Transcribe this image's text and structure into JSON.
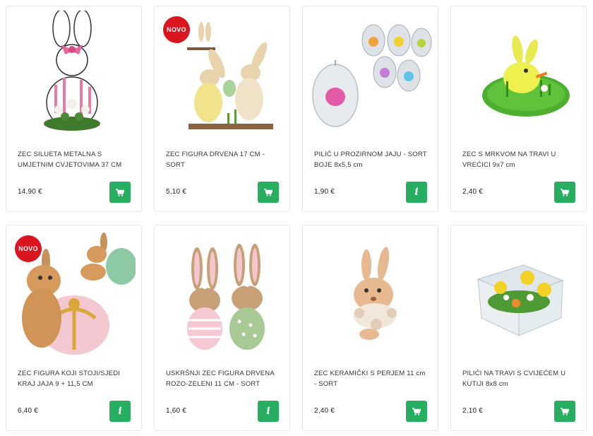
{
  "products": [
    {
      "title": "ZEC SILUETA METALNA S UMJETNIM CVJETOVIMA 37 CM",
      "price": "14,90 €",
      "badge": "",
      "action": "cart-icon"
    },
    {
      "title": "ZEC FIGURA DRVENA 17 CM - SORT",
      "price": "5,10 €",
      "badge": "NOVO",
      "action": "cart-icon"
    },
    {
      "title": "PILIĆ U PROZIRNOM JAJU - SORT BOJE 8x5,5 cm",
      "price": "1,90 €",
      "badge": "",
      "action": "info-icon"
    },
    {
      "title": "ZEC S MRKVOM NA TRAVI U VREĆICI 9x7 cm",
      "price": "2,40 €",
      "badge": "",
      "action": "cart-icon"
    },
    {
      "title": "ZEC FIGURA KOJI STOJI/SJEDI KRAJ JAJA 9 + 11,5 CM",
      "price": "6,40 €",
      "badge": "NOVO",
      "action": "info-icon"
    },
    {
      "title": "USKRŠNJI ZEC FIGURA DRVENA ROZO-ZELENI 11 CM - SORT",
      "price": "1,60 €",
      "badge": "",
      "action": "info-icon"
    },
    {
      "title": "ZEC KERAMIČKI S PERJEM 11 cm - SORT",
      "price": "2,40 €",
      "badge": "",
      "action": "cart-icon"
    },
    {
      "title": "PILIĆI NA TRAVI S CVIJEĆEM U KUTIJI 8x8 cm",
      "price": "2,10 €",
      "badge": "",
      "action": "cart-icon"
    }
  ],
  "colors": {
    "button": "#27ae60",
    "badge": "#d9151f"
  },
  "info_glyph": "i"
}
